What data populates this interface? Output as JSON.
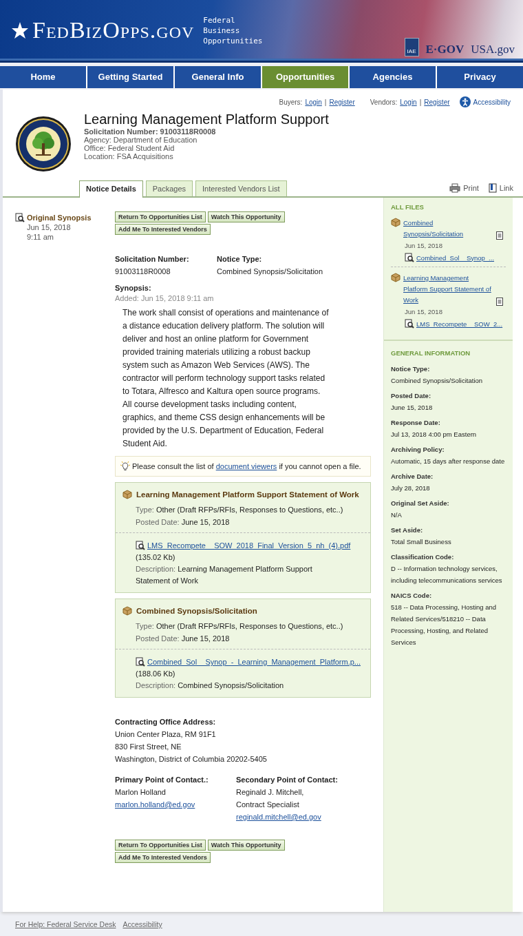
{
  "header": {
    "logo": "FedBizOpps.gov",
    "tagline": [
      "Federal",
      "Business",
      "Opportunities"
    ],
    "partners": [
      {
        "kind": "iae",
        "label": "IAE"
      },
      {
        "kind": "egov",
        "label": "E·GOV"
      },
      {
        "kind": "usa",
        "label": "USA.gov"
      }
    ]
  },
  "nav": [
    {
      "label": "Home",
      "selected": false
    },
    {
      "label": "Getting Started",
      "selected": false
    },
    {
      "label": "General Info",
      "selected": false
    },
    {
      "label": "Opportunities",
      "selected": true
    },
    {
      "label": "Agencies",
      "selected": false
    },
    {
      "label": "Privacy",
      "selected": false
    }
  ],
  "user_links": {
    "buyers_label": "Buyers:",
    "buyers": [
      "Login",
      "Register"
    ],
    "vendors_label": "Vendors:",
    "vendors": [
      "Login",
      "Register"
    ],
    "separator": "|",
    "accessibility": "Accessibility"
  },
  "notice": {
    "title": "Learning Management Platform Support",
    "solicitation": "Solicitation Number: 91003118R0008",
    "details": [
      "Agency: Department of Education",
      "Office: Federal Student Aid",
      "Location: FSA Acquisitions"
    ]
  },
  "tabs": [
    {
      "label": "Notice Details",
      "selected": true
    },
    {
      "label": "Packages",
      "selected": false
    },
    {
      "label": "Interested Vendors List",
      "selected": false
    }
  ],
  "tools": [
    {
      "kind": "print",
      "label": "Print"
    },
    {
      "kind": "link",
      "label": "Link"
    }
  ],
  "history": {
    "title": "Original Synopsis",
    "date": "Jun 15, 2018",
    "time": "9:11 am"
  },
  "buttons_top": [
    "Return To Opportunities List",
    "Watch This Opportunity",
    "Add Me To Interested Vendors"
  ],
  "summary": [
    {
      "label": "Solicitation Number:",
      "value": "91003118R0008"
    },
    {
      "label": "Notice Type:",
      "value": "Combined Synopsis/Solicitation"
    }
  ],
  "synopsis": {
    "label": "Synopsis:",
    "added": "Added: Jun 15, 2018 9:11 am",
    "text": "The work shall consist of operations and maintenance of a distance education delivery platform. The solution will deliver and host an online platform for Government provided training materials utilizing a robust backup system such as Amazon Web Services (AWS). The contractor will perform technology support tasks related to Totara, Alfresco and Kaltura open source programs.  All course development tasks including content, graphics, and theme CSS design enhancements will be provided by the U.S. Department of Education, Federal Student Aid."
  },
  "viewer_note": {
    "before": "Please consult the list of",
    "link": "document viewers",
    "after": "if you cannot open a file."
  },
  "packages": [
    {
      "title": "Learning Management Platform Support Statement of Work",
      "type_label": "Type:",
      "type": "Other (Draft RFPs/RFIs, Responses to Questions, etc..)",
      "posted_label": "Posted Date:",
      "posted": "June 15, 2018",
      "file": "LMS_Recompete__SOW_2018_Final_Version_5_nh_(4).pdf",
      "size": "(135.02 Kb)",
      "description_label": "Description:",
      "description": "Learning Management Platform Support Statement of Work"
    },
    {
      "title": "Combined Synopsis/Solicitation",
      "type_label": "Type:",
      "type": "Other (Draft RFPs/RFIs, Responses to Questions, etc..)",
      "posted_label": "Posted Date:",
      "posted": "June 15, 2018",
      "file": "Combined_Sol__Synop_-_Learning_Management_Platform.p...",
      "size": "(188.06 Kb)",
      "description_label": "Description:",
      "description": "Combined Synopsis/Solicitation"
    }
  ],
  "address": {
    "label": "Contracting Office Address:",
    "lines": [
      "Union Center Plaza, RM 91F1",
      "830 First Street, NE",
      "Washington, District of Columbia 20202-5405"
    ]
  },
  "contacts": [
    {
      "label": "Primary Point of Contact.:",
      "lines": [
        "Marlon Holland"
      ],
      "email": "marlon.holland@ed.gov"
    },
    {
      "label": "Secondary Point of Contact:",
      "lines": [
        "Reginald J. Mitchell,",
        "Contract Specialist"
      ],
      "email": "reginald.mitchell@ed.gov"
    }
  ],
  "buttons_bottom": [
    "Return To Opportunities List",
    "Watch This Opportunity",
    "Add Me To Interested Vendors"
  ],
  "all_files": {
    "title": "ALL FILES",
    "items": [
      {
        "name": "Combined Synopsis/Solicitation",
        "date": "Jun 15, 2018",
        "file": "Combined_Sol__Synop_..."
      },
      {
        "name": "Learning Management Platform Support Statement of Work",
        "date": "Jun 15, 2018",
        "file": "LMS_Recompete__SOW_2..."
      }
    ]
  },
  "general_information": {
    "title": "GENERAL INFORMATION",
    "items": [
      {
        "label": "Notice Type:",
        "value": "Combined Synopsis/Solicitation"
      },
      {
        "label": "Posted Date:",
        "value": "June 15, 2018"
      },
      {
        "label": "Response Date:",
        "value": "Jul 13, 2018 4:00 pm Eastern"
      },
      {
        "label": "Archiving Policy:",
        "value": "Automatic, 15 days after response date"
      },
      {
        "label": "Archive Date:",
        "value": "July 28, 2018"
      },
      {
        "label": "Original Set Aside:",
        "value": "N/A"
      },
      {
        "label": "Set Aside:",
        "value": "Total Small Business"
      },
      {
        "label": "Classification Code:",
        "value": "D -- Information technology services, including telecommunications services"
      },
      {
        "label": "NAICS Code:",
        "value": "518 -- Data Processing, Hosting and Related Services/518210 -- Data Processing, Hosting, and Related Services"
      }
    ]
  },
  "footer": [
    "For Help: Federal Service Desk",
    "Accessibility"
  ]
}
